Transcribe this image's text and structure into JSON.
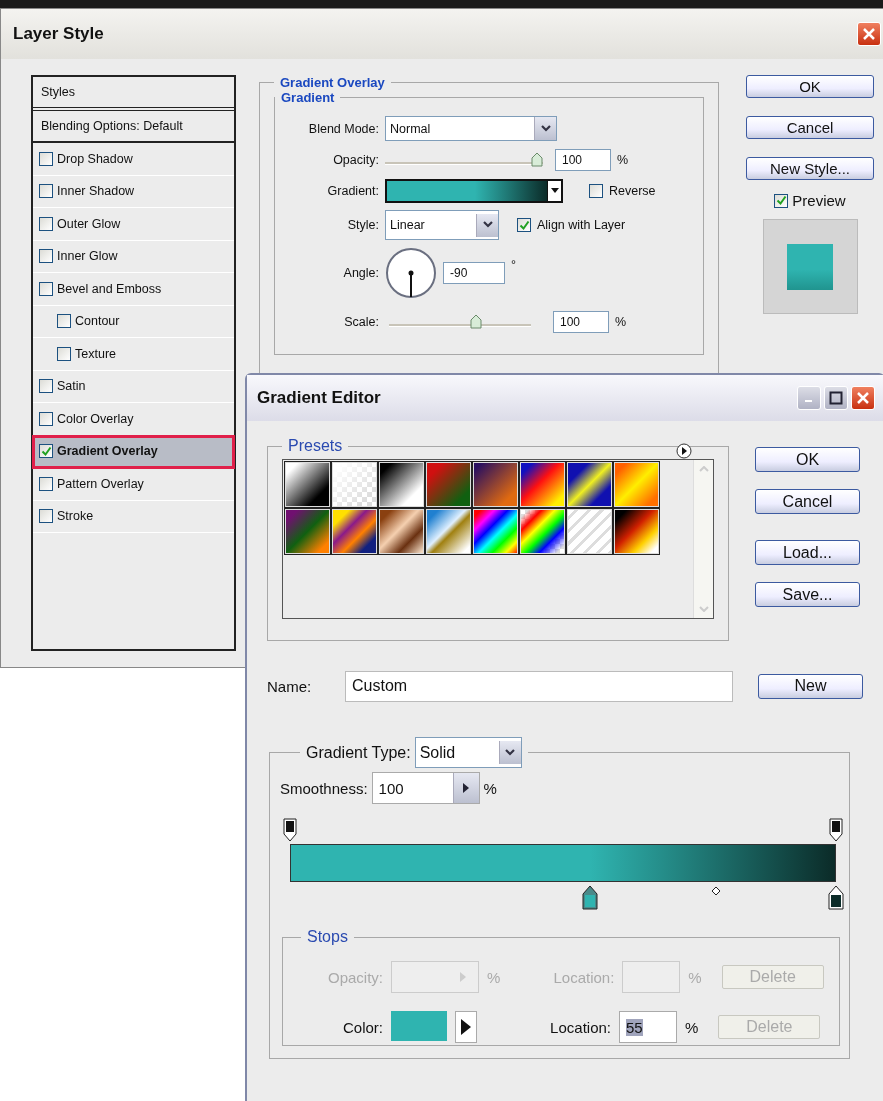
{
  "layer_style": {
    "title": "Layer Style",
    "styles_header": "Styles",
    "blending_options": "Blending Options: Default",
    "styles": [
      {
        "label": "Drop Shadow",
        "checked": false,
        "selected": false
      },
      {
        "label": "Inner Shadow",
        "checked": false,
        "selected": false
      },
      {
        "label": "Outer Glow",
        "checked": false,
        "selected": false
      },
      {
        "label": "Inner Glow",
        "checked": false,
        "selected": false
      },
      {
        "label": "Bevel and Emboss",
        "checked": false,
        "selected": false,
        "children": [
          {
            "label": "Contour",
            "checked": false,
            "selected": false
          },
          {
            "label": "Texture",
            "checked": false,
            "selected": false
          }
        ]
      },
      {
        "label": "Satin",
        "checked": false,
        "selected": false
      },
      {
        "label": "Color Overlay",
        "checked": false,
        "selected": false
      },
      {
        "label": "Gradient Overlay",
        "checked": true,
        "selected": true
      },
      {
        "label": "Pattern Overlay",
        "checked": false,
        "selected": false
      },
      {
        "label": "Stroke",
        "checked": false,
        "selected": false
      }
    ],
    "panel": {
      "title": "Gradient Overlay",
      "group": "Gradient",
      "blend_mode": {
        "label": "Blend Mode:",
        "value": "Normal"
      },
      "opacity": {
        "label": "Opacity:",
        "level": 1,
        "value": "100",
        "unit": "%"
      },
      "gradient": {
        "label": "Gradient:"
      },
      "reverse": {
        "label": "Reverse",
        "checked": false
      },
      "style": {
        "label": "Style:",
        "value": "Linear"
      },
      "align_with_layer": {
        "label": "Align with Layer",
        "checked": true
      },
      "angle": {
        "label": "Angle:",
        "value": "-90",
        "unit": "°"
      },
      "scale": {
        "label": "Scale:",
        "level": 0.62,
        "value": "100",
        "unit": "%"
      }
    },
    "buttons": [
      "OK",
      "Cancel",
      "New Style..."
    ],
    "preview": {
      "label": "Preview",
      "checked": true
    }
  },
  "gradient_editor": {
    "title": "Gradient Editor",
    "presets_title": "Presets",
    "buttons": [
      "OK",
      "Cancel",
      "Load...",
      "Save..."
    ],
    "name": {
      "label": "Name:",
      "value": "Custom"
    },
    "new_button": "New",
    "gradient_type": {
      "label": "Gradient Type:",
      "value": "Solid"
    },
    "smoothness": {
      "label": "Smoothness:",
      "value": "100",
      "unit": "%"
    },
    "color_stops": [
      {
        "color": "#2fb4b0",
        "selected": true
      },
      {
        "color": "#0b2b28",
        "selected": false
      }
    ],
    "stops": {
      "title": "Stops",
      "rows": [
        {
          "kind": "opacity",
          "label": "Opacity:",
          "unit": "%",
          "location_label": "Location:",
          "location_unit": "%",
          "delete": "Delete",
          "disabled": true
        },
        {
          "kind": "color",
          "label": "Color:",
          "location_label": "Location:",
          "location": "55",
          "location_unit": "%",
          "delete": "Delete",
          "disabled": false
        }
      ]
    }
  }
}
